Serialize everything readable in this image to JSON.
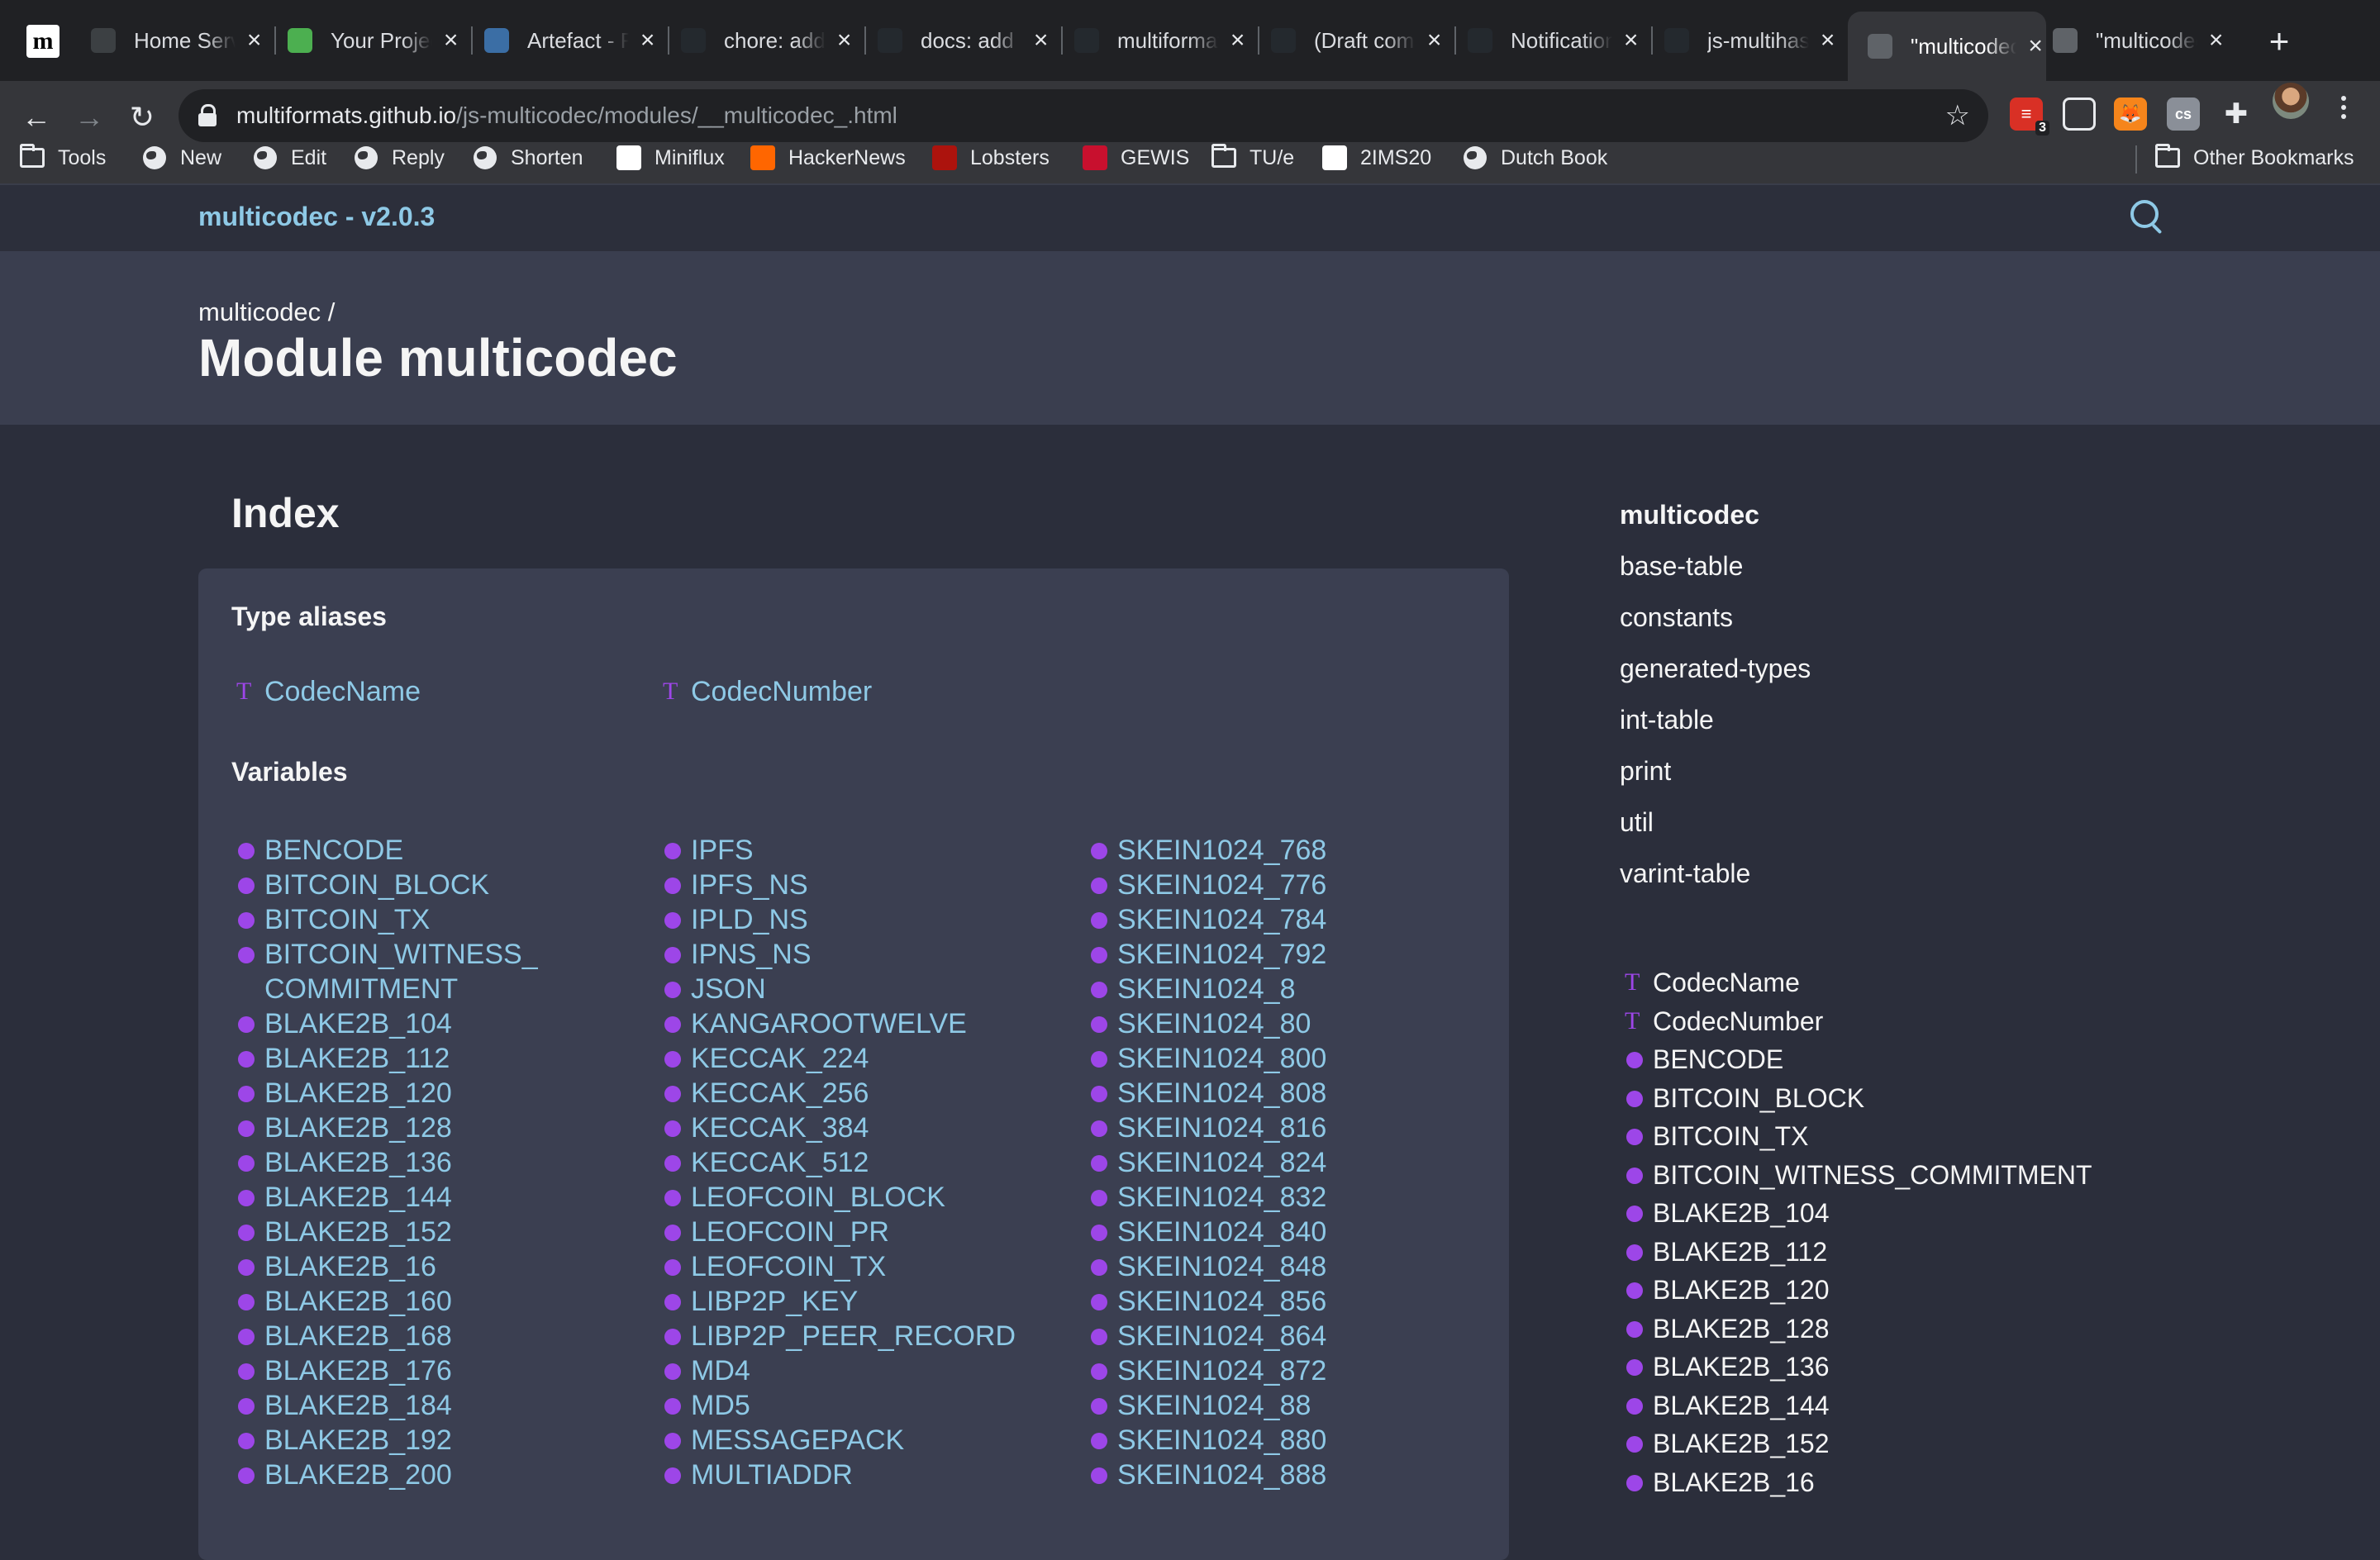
{
  "browser": {
    "tabs": [
      {
        "title": "Home Server",
        "icon": "document-icon",
        "color": "#3c4043",
        "active": false
      },
      {
        "title": "Your Projects",
        "icon": "leaf-icon",
        "color": "#4caf50",
        "active": false
      },
      {
        "title": "Artefact - RS Wiki",
        "icon": "rs-wiki-icon",
        "color": "#3b6ea5",
        "active": false
      },
      {
        "title": "chore: add",
        "icon": "github-fail-icon",
        "color": "#24292e",
        "active": false
      },
      {
        "title": "docs: add",
        "icon": "github-icon",
        "color": "#24292e",
        "active": false
      },
      {
        "title": "multiformats",
        "icon": "github-icon",
        "color": "#24292e",
        "active": false
      },
      {
        "title": "(Draft comment)",
        "icon": "github-icon",
        "color": "#24292e",
        "active": false
      },
      {
        "title": "Notifications",
        "icon": "github-icon",
        "color": "#24292e",
        "active": false
      },
      {
        "title": "js-multihash",
        "icon": "github-icon",
        "color": "#24292e",
        "active": false
      },
      {
        "title": "\"multicodec",
        "icon": "globe-icon",
        "color": "#5f6368",
        "active": true
      },
      {
        "title": "\"multicodec",
        "icon": "globe-icon",
        "color": "#5f6368",
        "active": false
      }
    ],
    "url_host": "multiformats.github.io",
    "url_path": "/js-multicodec/modules/__multicodec_.html",
    "extension_badge": "3",
    "bookmarks": [
      {
        "label": "Tools",
        "icon": "folder-icon"
      },
      {
        "label": "New",
        "icon": "globe-icon"
      },
      {
        "label": "Edit",
        "icon": "globe-icon"
      },
      {
        "label": "Reply",
        "icon": "globe-icon"
      },
      {
        "label": "Shorten",
        "icon": "globe-icon"
      },
      {
        "label": "Miniflux",
        "icon": "miniflux-icon"
      },
      {
        "label": "HackerNews",
        "icon": "hackernews-icon"
      },
      {
        "label": "Lobsters",
        "icon": "lobsters-icon"
      },
      {
        "label": "GEWIS",
        "icon": "gewis-icon"
      },
      {
        "label": "TU/e",
        "icon": "folder-icon"
      },
      {
        "label": "2IMS20",
        "icon": "tue-icon"
      },
      {
        "label": "Dutch Book",
        "icon": "globe-icon"
      }
    ],
    "other_bookmarks": "Other Bookmarks"
  },
  "page": {
    "brand": "multicodec - v2.0.3",
    "breadcrumb": "multicodec /",
    "title": "Module multicodec",
    "index_heading": "Index",
    "type_aliases_heading": "Type aliases",
    "type_aliases": [
      "CodecName",
      "CodecNumber"
    ],
    "variables_heading": "Variables",
    "variables_col1": [
      "BENCODE",
      "BITCOIN_BLOCK",
      "BITCOIN_TX",
      "BITCOIN_WITNESS_ COMMITMENT",
      "BLAKE2B_104",
      "BLAKE2B_112",
      "BLAKE2B_120",
      "BLAKE2B_128",
      "BLAKE2B_136",
      "BLAKE2B_144",
      "BLAKE2B_152",
      "BLAKE2B_16",
      "BLAKE2B_160",
      "BLAKE2B_168",
      "BLAKE2B_176",
      "BLAKE2B_184",
      "BLAKE2B_192",
      "BLAKE2B_200"
    ],
    "variables_col2": [
      "IPFS",
      "IPFS_NS",
      "IPLD_NS",
      "IPNS_NS",
      "JSON",
      "KANGAROOTWELVE",
      "KECCAK_224",
      "KECCAK_256",
      "KECCAK_384",
      "KECCAK_512",
      "LEOFCOIN_BLOCK",
      "LEOFCOIN_PR",
      "LEOFCOIN_TX",
      "LIBP2P_KEY",
      "LIBP2P_PEER_RECORD",
      "MD4",
      "MD5",
      "MESSAGEPACK",
      "MULTIADDR"
    ],
    "variables_col3": [
      "SKEIN1024_768",
      "SKEIN1024_776",
      "SKEIN1024_784",
      "SKEIN1024_792",
      "SKEIN1024_8",
      "SKEIN1024_80",
      "SKEIN1024_800",
      "SKEIN1024_808",
      "SKEIN1024_816",
      "SKEIN1024_824",
      "SKEIN1024_832",
      "SKEIN1024_840",
      "SKEIN1024_848",
      "SKEIN1024_856",
      "SKEIN1024_864",
      "SKEIN1024_872",
      "SKEIN1024_88",
      "SKEIN1024_880",
      "SKEIN1024_888"
    ],
    "side_nav": [
      "multicodec",
      "base-table",
      "constants",
      "generated-types",
      "int-table",
      "print",
      "util",
      "varint-table"
    ],
    "side_members": [
      {
        "label": "CodecName",
        "kind": "type"
      },
      {
        "label": "CodecNumber",
        "kind": "type"
      },
      {
        "label": "BENCODE",
        "kind": "variable"
      },
      {
        "label": "BITCOIN_BLOCK",
        "kind": "variable"
      },
      {
        "label": "BITCOIN_TX",
        "kind": "variable"
      },
      {
        "label": "BITCOIN_WITNESS_COMMITMENT",
        "kind": "variable"
      },
      {
        "label": "BLAKE2B_104",
        "kind": "variable"
      },
      {
        "label": "BLAKE2B_112",
        "kind": "variable"
      },
      {
        "label": "BLAKE2B_120",
        "kind": "variable"
      },
      {
        "label": "BLAKE2B_128",
        "kind": "variable"
      },
      {
        "label": "BLAKE2B_136",
        "kind": "variable"
      },
      {
        "label": "BLAKE2B_144",
        "kind": "variable"
      },
      {
        "label": "BLAKE2B_152",
        "kind": "variable"
      },
      {
        "label": "BLAKE2B_16",
        "kind": "variable"
      }
    ],
    "colors": {
      "link": "#8ec9e6",
      "accent": "#9d46e8",
      "background": "#2b2e3b",
      "panel": "#3b3f51"
    }
  }
}
